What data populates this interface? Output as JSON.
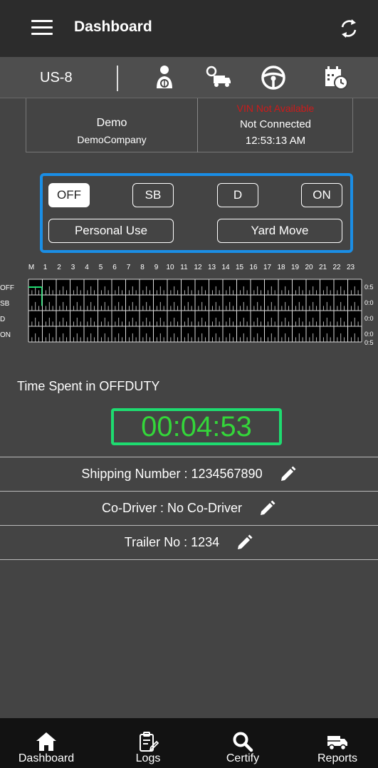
{
  "header": {
    "title": "Dashboard"
  },
  "status": {
    "rule": "US-8"
  },
  "driver": {
    "name": "Demo",
    "company": "DemoCompany",
    "vin": "VIN Not Available",
    "connection": "Not Connected",
    "time": "12:53:13 AM"
  },
  "duty": {
    "off": "OFF",
    "sb": "SB",
    "d": "D",
    "on": "ON",
    "personal_use": "Personal Use",
    "yard_move": "Yard Move",
    "active": "OFF"
  },
  "graph": {
    "hour_labels": [
      "M",
      "1",
      "2",
      "3",
      "4",
      "5",
      "6",
      "7",
      "8",
      "9",
      "10",
      "11",
      "12",
      "13",
      "14",
      "15",
      "16",
      "17",
      "18",
      "19",
      "20",
      "21",
      "22",
      "23"
    ],
    "rows": [
      "OFF",
      "SB",
      "D",
      "ON"
    ],
    "totals": [
      "0:5",
      "0:0",
      "0:0",
      "0:0"
    ],
    "on_total_second": "0:5",
    "current_status": "OFF",
    "off_segment_hours": 0.08
  },
  "timer": {
    "label": "Time Spent in OFFDUTY",
    "value": "00:04:53"
  },
  "info": {
    "shipping": "Shipping Number : 1234567890",
    "codriver": "Co-Driver : No Co-Driver",
    "trailer": "Trailer No : 1234"
  },
  "nav": {
    "dashboard": "Dashboard",
    "logs": "Logs",
    "certify": "Certify",
    "reports": "Reports"
  },
  "colors": {
    "accent_blue": "#1a8ee6",
    "timer_green": "#34d63a",
    "vin_red": "#cc1b1b",
    "graph_line": "#1edc70"
  }
}
